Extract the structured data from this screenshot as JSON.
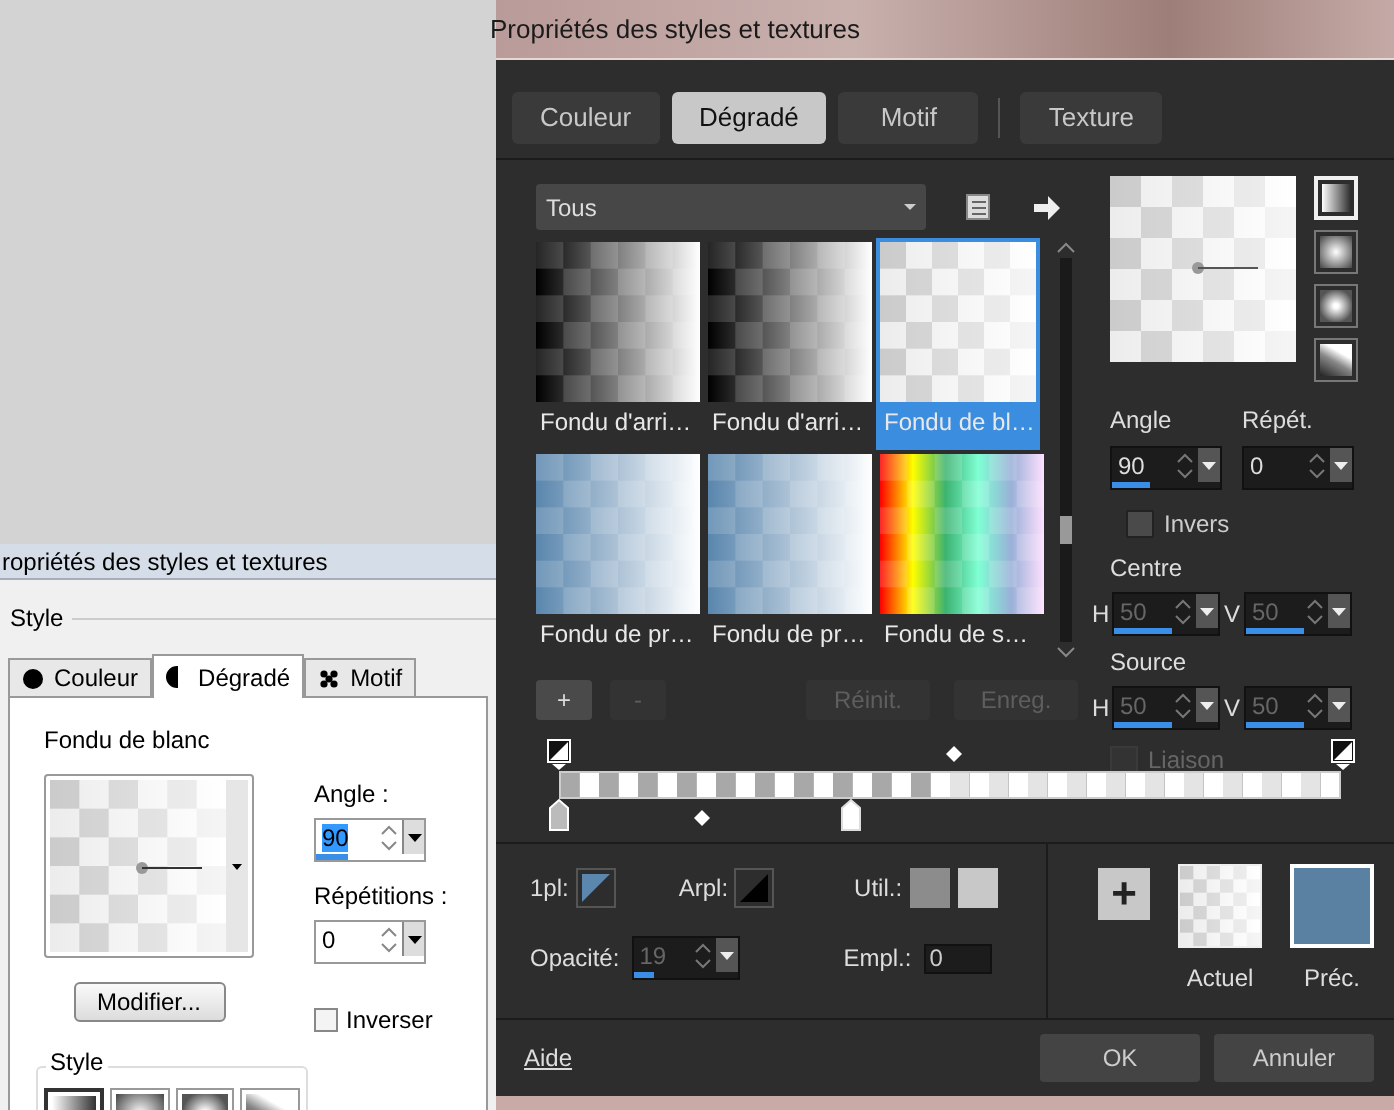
{
  "background_window": {
    "title": "ropriétés des styles et textures",
    "section_label": "Style",
    "tabs": [
      {
        "label": "Couleur",
        "kind": "color",
        "selected": false
      },
      {
        "label": "Dégradé",
        "kind": "gradient",
        "selected": true
      },
      {
        "label": "Motif",
        "kind": "pattern",
        "selected": false
      }
    ],
    "gradient_name": "Fondu de blanc",
    "angle": {
      "label": "Angle :",
      "value": "90",
      "level": 0.3
    },
    "repetitions": {
      "label": "Répétitions :",
      "value": "0"
    },
    "modify_button": "Modifier...",
    "invert": {
      "label": "Inverser",
      "checked": false
    },
    "style_group": {
      "label": "Style",
      "options": [
        {
          "kind": "linear",
          "selected": true
        },
        {
          "kind": "rectangular",
          "selected": false
        },
        {
          "kind": "sunburst",
          "selected": false
        },
        {
          "kind": "radial",
          "selected": false
        }
      ]
    }
  },
  "dialog": {
    "title": "Propriétés des styles et textures",
    "tabs": [
      {
        "label": "Couleur",
        "selected": false
      },
      {
        "label": "Dégradé",
        "selected": true
      },
      {
        "label": "Motif",
        "selected": false
      },
      {
        "label": "Texture",
        "selected": false
      }
    ],
    "category": "Tous",
    "gallery": [
      {
        "label": "Fondu d'arri…",
        "kind": "black",
        "selected": false
      },
      {
        "label": "Fondu d'arri…",
        "kind": "black",
        "selected": false
      },
      {
        "label": "Fondu de bl…",
        "kind": "white",
        "selected": true
      },
      {
        "label": "Fondu de pr…",
        "kind": "blue",
        "selected": false
      },
      {
        "label": "Fondu de pr…",
        "kind": "blue",
        "selected": false
      },
      {
        "label": "Fondu de s…",
        "kind": "spectrum",
        "selected": false
      }
    ],
    "gallery_buttons": [
      {
        "label": "+",
        "disabled": false
      },
      {
        "label": "-",
        "disabled": true
      },
      {
        "label": "Réinit.",
        "disabled": true
      },
      {
        "label": "Enreg.",
        "disabled": true
      }
    ],
    "style_options": [
      {
        "kind": "linear",
        "selected": true
      },
      {
        "kind": "rectangular",
        "selected": false
      },
      {
        "kind": "sunburst",
        "selected": false
      },
      {
        "kind": "radial",
        "selected": false
      }
    ],
    "angle": {
      "label": "Angle",
      "value": "90",
      "level": 0.35,
      "disabled": false
    },
    "repeat": {
      "label": "Répét.",
      "value": "0",
      "disabled": false
    },
    "invert": {
      "label": "Invers",
      "checked": false,
      "disabled": false
    },
    "center": {
      "label": "Centre",
      "fields": [
        {
          "axis": "H",
          "value": "50",
          "level": 0.55,
          "disabled": true
        },
        {
          "axis": "V",
          "value": "50",
          "level": 0.55,
          "disabled": true
        }
      ]
    },
    "source": {
      "label": "Source",
      "fields": [
        {
          "axis": "H",
          "value": "50",
          "level": 0.55,
          "disabled": true
        },
        {
          "axis": "V",
          "value": "50",
          "level": 0.55,
          "disabled": true
        }
      ]
    },
    "link": {
      "label": "Liaison",
      "checked": false,
      "disabled": true
    },
    "first_label": "1pl:",
    "back_label": "Arpl:",
    "use_label": "Util.:",
    "use_swatches": [
      {
        "color": "#8c8c8c"
      },
      {
        "color": "#c8c8c8"
      }
    ],
    "opacity": {
      "label": "Opacité:",
      "value": "19",
      "level": 0.19,
      "disabled": true
    },
    "location": {
      "label": "Empl.:",
      "value": "0"
    },
    "preview": {
      "add_button": "+",
      "current_label": "Actuel",
      "previous_label": "Préc."
    },
    "help_link": "Aide",
    "ok_button": "OK",
    "cancel_button": "Annuler"
  }
}
